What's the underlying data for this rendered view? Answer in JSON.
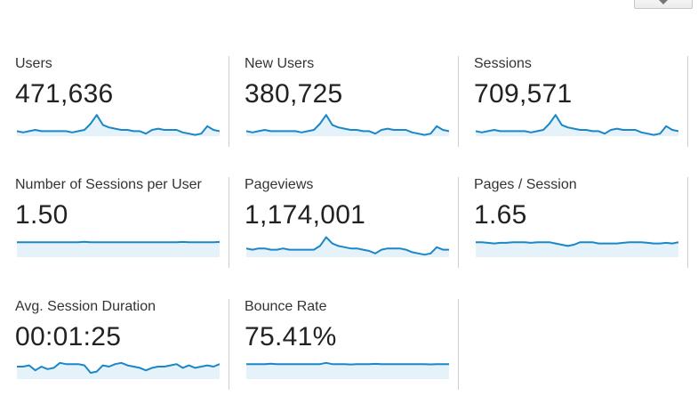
{
  "colors": {
    "line": "#1a87c8",
    "fill": "#e6f2f9",
    "divider": "#cfcfcf"
  },
  "toolbar": {
    "dropdown_icon": "chevron-down-icon"
  },
  "metrics": [
    {
      "id": "users",
      "label": "Users",
      "value": "471,636",
      "trend": [
        4,
        3,
        4,
        5,
        4,
        4,
        4,
        4,
        4,
        3,
        4,
        5,
        10,
        17,
        9,
        7,
        6,
        5,
        5,
        4,
        4,
        2,
        5,
        6,
        5,
        5,
        5,
        3,
        2,
        1,
        2,
        8,
        5,
        4
      ]
    },
    {
      "id": "new-users",
      "label": "New Users",
      "value": "380,725",
      "trend": [
        4,
        3,
        4,
        5,
        4,
        4,
        4,
        4,
        4,
        3,
        4,
        5,
        10,
        17,
        9,
        7,
        6,
        5,
        5,
        4,
        4,
        2,
        5,
        6,
        5,
        5,
        5,
        3,
        2,
        1,
        2,
        8,
        5,
        4
      ]
    },
    {
      "id": "sessions",
      "label": "Sessions",
      "value": "709,571",
      "trend": [
        4,
        3,
        4,
        5,
        4,
        4,
        4,
        4,
        4,
        3,
        4,
        5,
        10,
        17,
        9,
        7,
        6,
        5,
        5,
        4,
        4,
        2,
        5,
        6,
        5,
        5,
        5,
        3,
        2,
        1,
        2,
        8,
        5,
        4
      ]
    },
    {
      "id": "sessions-per-user",
      "label": "Number of Sessions per User",
      "value": "1.50",
      "trend": [
        12,
        12,
        12,
        12,
        12,
        12,
        12,
        12,
        12,
        12,
        12,
        12.3,
        12,
        12,
        12,
        12,
        12,
        12,
        12,
        12,
        12,
        12,
        12,
        12,
        12,
        12,
        12,
        12.2,
        12,
        12,
        12,
        12,
        12,
        12.2
      ]
    },
    {
      "id": "pageviews",
      "label": "Pageviews",
      "value": "1,174,001",
      "trend": [
        7,
        6,
        7,
        7,
        6,
        6,
        7,
        6,
        6,
        6,
        6,
        6,
        9,
        16,
        11,
        9,
        8,
        7,
        7,
        6,
        5,
        3,
        6,
        7,
        7,
        7,
        6,
        4,
        3,
        2,
        3,
        8,
        6,
        6
      ]
    },
    {
      "id": "pages-per-session",
      "label": "Pages / Session",
      "value": "1.65",
      "trend": [
        12,
        12,
        11.5,
        11,
        11.5,
        11.5,
        12,
        12,
        12,
        11.5,
        12,
        12,
        12,
        11,
        10,
        9,
        10,
        12,
        12,
        12,
        11,
        11,
        11,
        11,
        11.5,
        12,
        12,
        12,
        11.5,
        11,
        11,
        11.5,
        11,
        12
      ]
    },
    {
      "id": "avg-session-duration",
      "label": "Avg. Session Duration",
      "value": "00:01:25",
      "trend": [
        10,
        10,
        11,
        7,
        10,
        8,
        9,
        13,
        12,
        12,
        12,
        11,
        5,
        6,
        11,
        10,
        12,
        13,
        11,
        10,
        9,
        7,
        9,
        10,
        10,
        11,
        12,
        9,
        11,
        9,
        10,
        11,
        10,
        12
      ]
    },
    {
      "id": "bounce-rate",
      "label": "Bounce Rate",
      "value": "75.41%",
      "trend": [
        12,
        12,
        12,
        12,
        12.3,
        12,
        12,
        12,
        12,
        12,
        12,
        12,
        12,
        13,
        12,
        12,
        12,
        11.7,
        12,
        12,
        12,
        12.2,
        12,
        12,
        12,
        12,
        12,
        12,
        12,
        12,
        11.8,
        12,
        12,
        12
      ]
    }
  ]
}
